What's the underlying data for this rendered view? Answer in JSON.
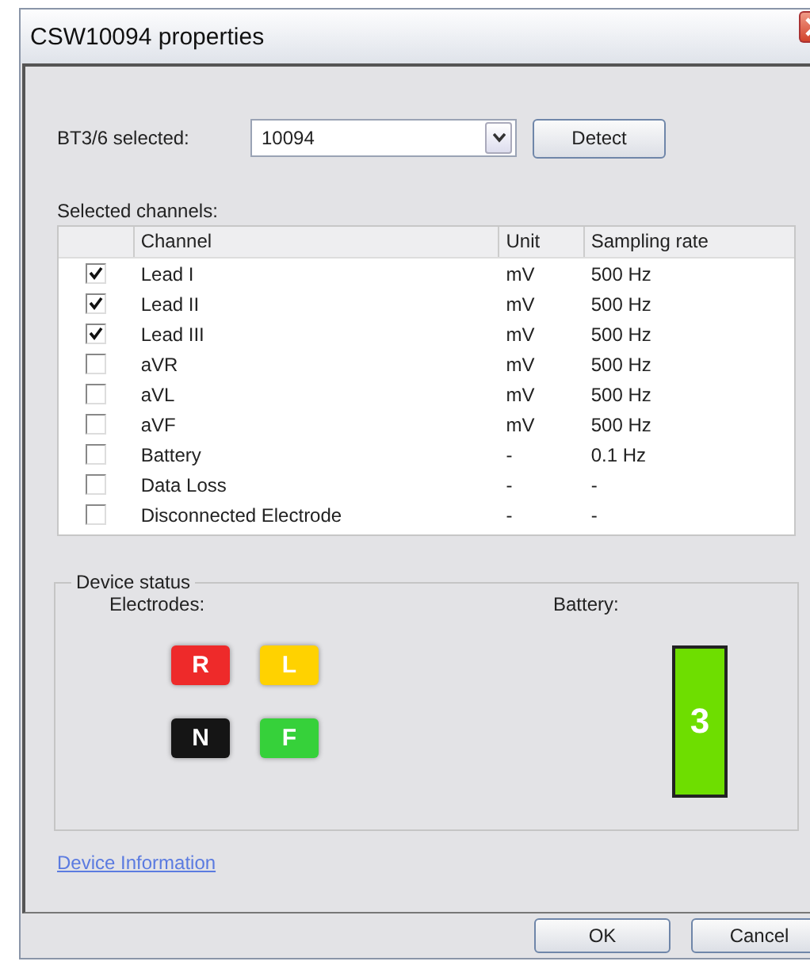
{
  "window": {
    "title": "CSW10094 properties"
  },
  "device_select": {
    "label": "BT3/6 selected:",
    "value": "10094",
    "button": "Detect"
  },
  "channels_label": "Selected channels:",
  "table": {
    "columns": [
      "Channel",
      "Unit",
      "Sampling rate"
    ],
    "rows": [
      {
        "checked": true,
        "channel": "Lead I",
        "unit": "mV",
        "rate": "500 Hz"
      },
      {
        "checked": true,
        "channel": "Lead II",
        "unit": "mV",
        "rate": "500 Hz"
      },
      {
        "checked": true,
        "channel": "Lead III",
        "unit": "mV",
        "rate": "500 Hz"
      },
      {
        "checked": false,
        "channel": "aVR",
        "unit": "mV",
        "rate": "500 Hz"
      },
      {
        "checked": false,
        "channel": "aVL",
        "unit": "mV",
        "rate": "500 Hz"
      },
      {
        "checked": false,
        "channel": "aVF",
        "unit": "mV",
        "rate": "500 Hz"
      },
      {
        "checked": false,
        "channel": "Battery",
        "unit": "-",
        "rate": "0.1 Hz"
      },
      {
        "checked": false,
        "channel": "Data Loss",
        "unit": "-",
        "rate": "-"
      },
      {
        "checked": false,
        "channel": "Disconnected Electrode",
        "unit": "-",
        "rate": "-"
      }
    ]
  },
  "device_status": {
    "title": "Device status",
    "electrodes_label": "Electrodes:",
    "electrodes": [
      {
        "label": "R",
        "color": "#ee2a2a"
      },
      {
        "label": "L",
        "color": "#ffd200"
      },
      {
        "label": "N",
        "color": "#151515"
      },
      {
        "label": "F",
        "color": "#36d13a"
      }
    ],
    "battery_label": "Battery:",
    "battery": {
      "value": "3",
      "color": "#6ede00"
    }
  },
  "link": "Device Information",
  "buttons": [
    "OK",
    "Cancel"
  ]
}
